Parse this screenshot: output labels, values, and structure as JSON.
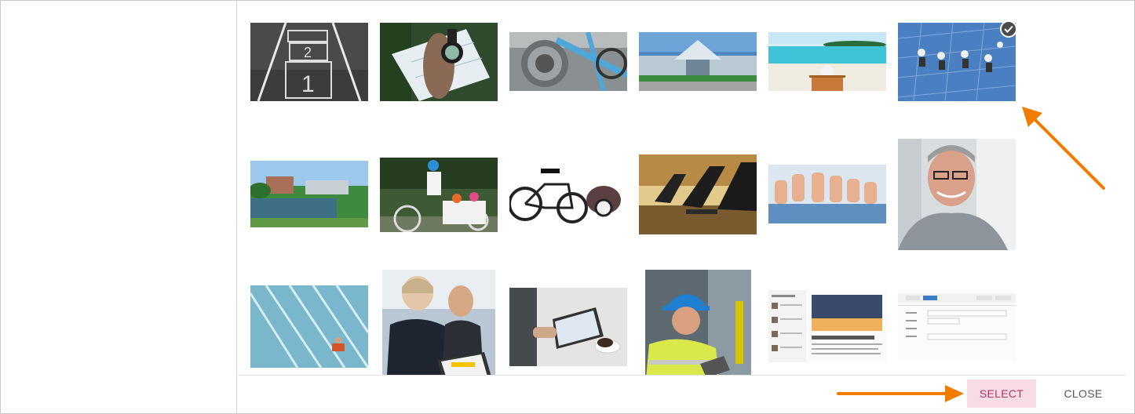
{
  "dialog": {
    "select_label": "SELECT",
    "close_label": "CLOSE"
  },
  "gallery": {
    "selected_index": 5,
    "images": [
      {
        "name": "hopscotch-road-image"
      },
      {
        "name": "compass-map-image"
      },
      {
        "name": "bike-gears-image"
      },
      {
        "name": "glass-building-image"
      },
      {
        "name": "beach-chair-image"
      },
      {
        "name": "window-cleaners-image"
      },
      {
        "name": "campus-lake-image"
      },
      {
        "name": "cargo-bike-family-image"
      },
      {
        "name": "bike-trailer-image"
      },
      {
        "name": "office-monitors-image"
      },
      {
        "name": "thumbs-up-image"
      },
      {
        "name": "smiling-man-glasses-image"
      },
      {
        "name": "stadium-seats-image"
      },
      {
        "name": "people-tablet-image"
      },
      {
        "name": "tablet-coffee-image"
      },
      {
        "name": "hard-hat-worker-image"
      },
      {
        "name": "news-screenshot-image"
      },
      {
        "name": "form-screenshot-image"
      }
    ]
  },
  "colors": {
    "accent_arrow": "#f07d00",
    "select_bg": "#f7dce6",
    "select_text": "#b03565"
  },
  "annotation_icons": [
    "arrow-to-selected-icon",
    "arrow-to-select-button-icon"
  ]
}
